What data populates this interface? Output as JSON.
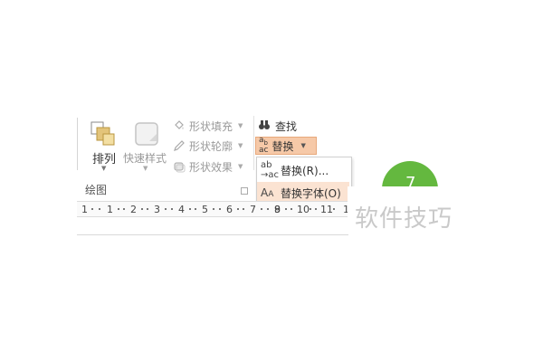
{
  "ribbon": {
    "arrange_label": "排列",
    "quick_styles_label": "快速样式",
    "shape_fill_label": "形状填充",
    "shape_outline_label": "形状轮廓",
    "shape_effects_label": "形状效果",
    "group_label": "绘图",
    "find_label": "查找",
    "replace_label": "替换"
  },
  "dropdown": {
    "items": [
      {
        "label": "替换(R)..."
      },
      {
        "label": "替换字体(O)"
      }
    ]
  },
  "ruler": {
    "numbers": [
      "1",
      "1",
      "2",
      "3",
      "4",
      "5",
      "6",
      "7",
      "8",
      "9",
      "10",
      "11",
      "1"
    ]
  },
  "circle": {
    "number": "7"
  },
  "watermark": {
    "text": "软件技巧"
  },
  "colors": {
    "replace_highlight": "#f6c9a8",
    "menu_hover": "#fbe3d2",
    "green_circle": "#64b83f"
  },
  "icons": {
    "arrange": "arrange-icon",
    "quick_styles": "quick-styles-icon",
    "shape_fill": "paint-bucket-icon",
    "shape_outline": "pen-icon",
    "shape_effects": "effects-icon",
    "find": "binoculars-icon",
    "replace": "replace-icon",
    "replace_font": "replace-font-icon"
  }
}
